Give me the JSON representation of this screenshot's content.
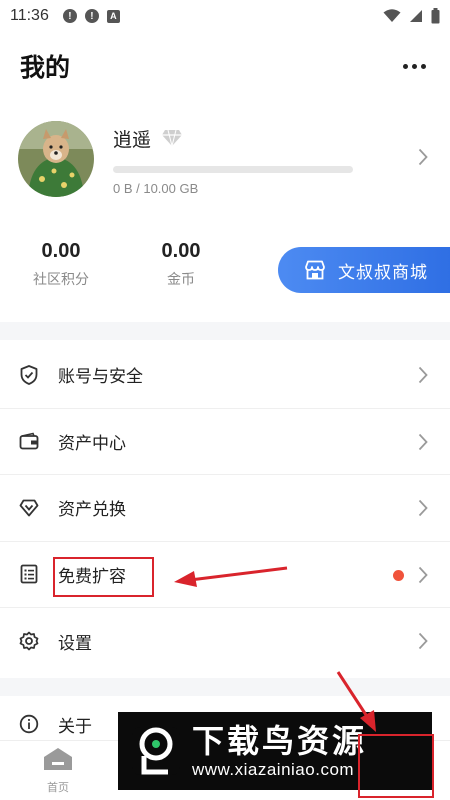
{
  "status_bar": {
    "time": "11:36",
    "notif_a": "A"
  },
  "header": {
    "title": "我的"
  },
  "profile": {
    "username": "逍遥",
    "storage_text": "0 B / 10.00 GB",
    "storage_used_fraction": 0
  },
  "stats": [
    {
      "value": "0.00",
      "label": "社区积分"
    },
    {
      "value": "0.00",
      "label": "金币"
    }
  ],
  "mall_button": {
    "label": "文叔叔商城"
  },
  "menu": [
    {
      "label": "账号与安全",
      "icon": "shield-check-icon"
    },
    {
      "label": "资产中心",
      "icon": "wallet-icon"
    },
    {
      "label": "资产兑换",
      "icon": "diamond-icon"
    },
    {
      "label": "免费扩容",
      "icon": "list-icon",
      "badge": "red-dot"
    },
    {
      "label": "设置",
      "icon": "gear-icon"
    },
    {
      "label": "关于",
      "icon": "info-icon"
    }
  ],
  "tabbar": {
    "home_label": "首页"
  },
  "watermark": {
    "title": "下载鸟资源",
    "url": "www.xiazainiao.com"
  },
  "colors": {
    "accent": "#3a7bea",
    "annotation": "#d9242c",
    "badge": "#f0533b"
  }
}
